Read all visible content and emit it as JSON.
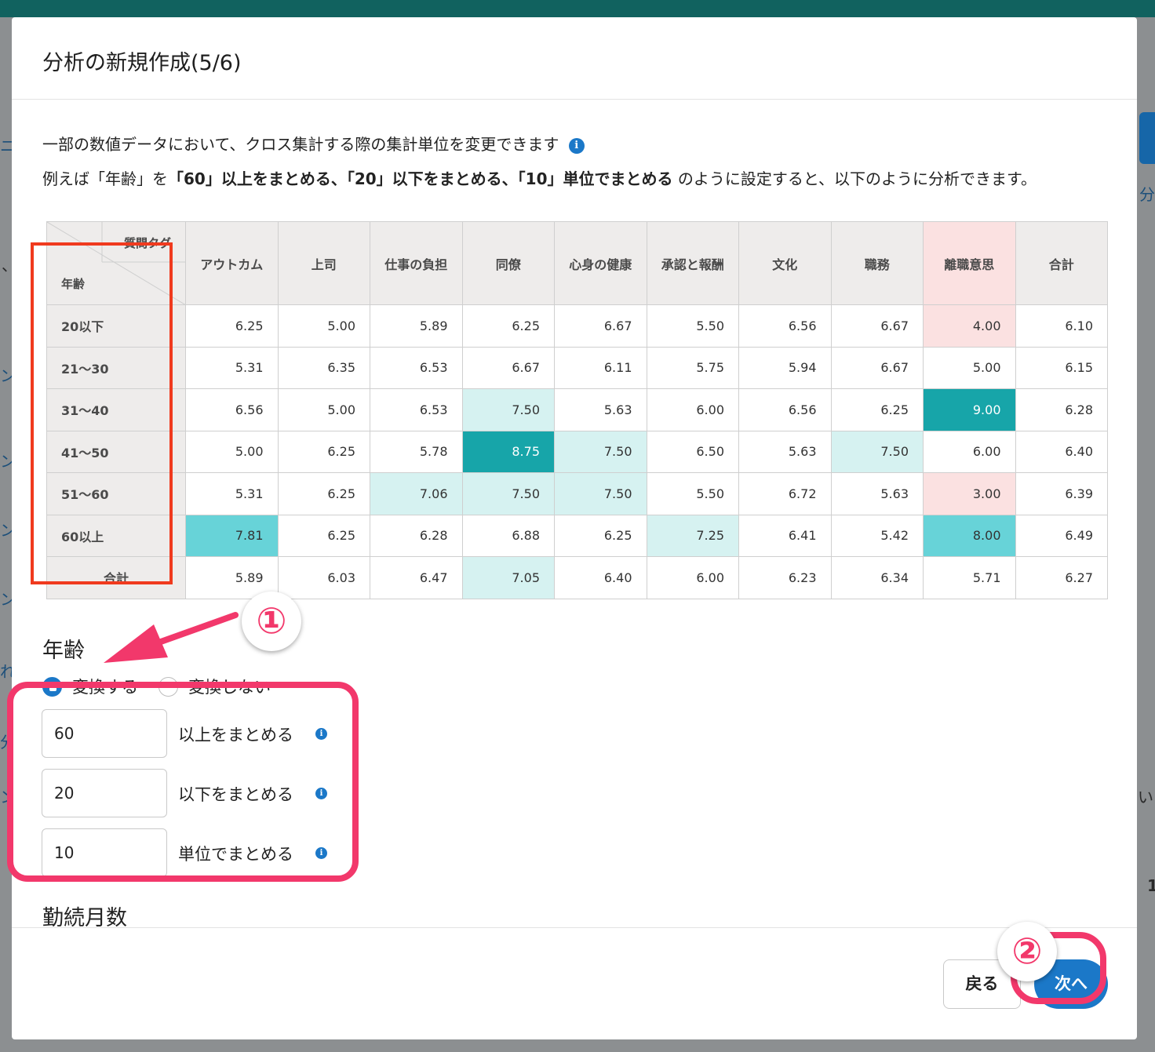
{
  "background": {
    "fragments": [
      "ニ",
      "分",
      "ン",
      "ン",
      "ン",
      "ン",
      "れ",
      "分",
      "ン",
      "い",
      "1",
      "、"
    ]
  },
  "modal": {
    "title": "分析の新規作成(5/6)",
    "description_line1": "一部の数値データにおいて、クロス集計する際の集計単位を変更できます",
    "description_line2_pre": "例えば「年齢」を",
    "description_line2_bold": "「60」以上をまとめる、「20」以下をまとめる、「10」単位でまとめる",
    "description_line2_post": "のように設定すると、以下のように分析できます。",
    "info_glyph": "i"
  },
  "sample_table": {
    "corner_top": "質問タグ",
    "corner_left": "年齢",
    "columns": [
      "アウトカム",
      "上司",
      "仕事の負担",
      "同僚",
      "心身の健康",
      "承認と報酬",
      "文化",
      "職務",
      "離職意思",
      "合計"
    ],
    "rows": [
      {
        "label": "20以下",
        "values": [
          "6.25",
          "5.00",
          "5.89",
          "6.25",
          "6.67",
          "5.50",
          "6.56",
          "6.67",
          "4.00",
          "6.10"
        ]
      },
      {
        "label": "21〜30",
        "values": [
          "5.31",
          "6.35",
          "6.53",
          "6.67",
          "6.11",
          "5.75",
          "5.94",
          "6.67",
          "5.00",
          "6.15"
        ]
      },
      {
        "label": "31〜40",
        "values": [
          "6.56",
          "5.00",
          "6.53",
          "7.50",
          "5.63",
          "6.00",
          "6.56",
          "6.25",
          "9.00",
          "6.28"
        ]
      },
      {
        "label": "41〜50",
        "values": [
          "5.00",
          "6.25",
          "5.78",
          "8.75",
          "7.50",
          "6.50",
          "5.63",
          "7.50",
          "6.00",
          "6.40"
        ]
      },
      {
        "label": "51〜60",
        "values": [
          "5.31",
          "6.25",
          "7.06",
          "7.50",
          "7.50",
          "5.50",
          "6.72",
          "5.63",
          "3.00",
          "6.39"
        ]
      },
      {
        "label": "60以上",
        "values": [
          "7.81",
          "6.25",
          "6.28",
          "6.88",
          "6.25",
          "7.25",
          "6.41",
          "5.42",
          "8.00",
          "6.49"
        ]
      },
      {
        "label": "合計",
        "values": [
          "5.89",
          "6.03",
          "6.47",
          "7.05",
          "6.40",
          "6.00",
          "6.23",
          "6.34",
          "5.71",
          "6.27"
        ]
      }
    ],
    "highlight": [
      [
        "",
        "",
        "",
        "",
        "",
        "",
        "",
        "",
        "pink",
        ""
      ],
      [
        "",
        "",
        "",
        "",
        "",
        "",
        "",
        "",
        "",
        ""
      ],
      [
        "",
        "",
        "",
        "light",
        "",
        "",
        "",
        "",
        "dark",
        ""
      ],
      [
        "",
        "",
        "",
        "dark",
        "light",
        "",
        "",
        "light",
        "",
        ""
      ],
      [
        "",
        "",
        "light",
        "light",
        "light",
        "",
        "",
        "",
        "pink",
        ""
      ],
      [
        "mid",
        "",
        "",
        "",
        "",
        "light",
        "",
        "",
        "mid",
        ""
      ],
      [
        "",
        "",
        "",
        "light",
        "",
        "",
        "",
        "",
        "",
        ""
      ]
    ],
    "colors": {
      "light": "#d6f2f1",
      "mid": "#67d3d8",
      "dark": "#17a5a9",
      "pink": "#fbe1e1"
    }
  },
  "age_section": {
    "title": "年齢",
    "radio_convert": "変換する",
    "radio_no_convert": "変換しない",
    "selected": "変換する",
    "upper_value": "60",
    "upper_label": "以上をまとめる",
    "lower_value": "20",
    "lower_label": "以下をまとめる",
    "unit_value": "10",
    "unit_label": "単位でまとめる"
  },
  "tenure_section": {
    "title": "勤続月数"
  },
  "footer": {
    "back_label": "戻る",
    "next_label": "次へ"
  },
  "annotations": {
    "badge1": "①",
    "badge2": "②",
    "accent": "#f2386b",
    "red_box": "#f03a1e"
  }
}
